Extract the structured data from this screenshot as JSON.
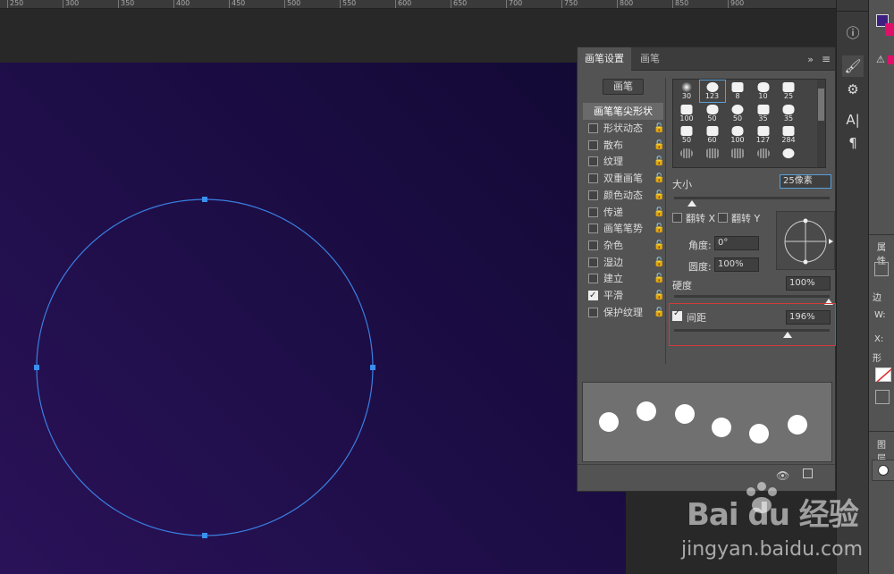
{
  "ruler": {
    "ticks": [
      "250",
      "300",
      "350",
      "400",
      "450",
      "500",
      "550",
      "600",
      "650",
      "700",
      "750",
      "800",
      "850",
      "900"
    ]
  },
  "panel": {
    "tabs": [
      "画笔设置",
      "画笔"
    ],
    "more_glyph": "»",
    "menu_glyph": "≡",
    "brush_button": "画笔",
    "tip_shape": "画笔笔尖形状",
    "lock_glyph": "🔓",
    "options": [
      {
        "label": "形状动态",
        "checked": false
      },
      {
        "label": "散布",
        "checked": false
      },
      {
        "label": "纹理",
        "checked": false
      },
      {
        "label": "双重画笔",
        "checked": false
      },
      {
        "label": "颜色动态",
        "checked": false
      },
      {
        "label": "传递",
        "checked": false
      },
      {
        "label": "画笔笔势",
        "checked": false
      },
      {
        "label": "杂色",
        "checked": false
      },
      {
        "label": "湿边",
        "checked": false
      },
      {
        "label": "建立",
        "checked": false
      },
      {
        "label": "平滑",
        "checked": true
      },
      {
        "label": "保护纹理",
        "checked": false
      }
    ],
    "presets": [
      "30",
      "123",
      "8",
      "10",
      "25",
      "100",
      "50",
      "50",
      "35",
      "35",
      "50",
      "60",
      "100",
      "127",
      "284",
      "",
      "",
      "",
      "",
      ""
    ],
    "size_label": "大小",
    "size_value": "25像素",
    "flip_x": "翻转 X",
    "flip_y": "翻转 Y",
    "angle_label": "角度:",
    "angle_value": "0°",
    "roundness_label": "圆度:",
    "roundness_value": "100%",
    "hardness_label": "硬度",
    "hardness_value": "100%",
    "spacing_label": "间距",
    "spacing_value": "196%",
    "spacing_checked": true,
    "footer_icons": [
      "eye-icon",
      "new-preset-icon"
    ]
  },
  "tools": [
    {
      "icon": "info-icon",
      "glyph": "ⓘ"
    },
    {
      "icon": "brush-icon",
      "glyph": "🖌"
    },
    {
      "icon": "sliders-icon",
      "glyph": "⚙"
    },
    {
      "icon": "character-icon",
      "glyph": "A|"
    },
    {
      "icon": "paragraph-icon",
      "glyph": "¶"
    }
  ],
  "dock": {
    "properties_label": "属性",
    "edge_label": "边",
    "w_label": "W:",
    "x_label": "X:",
    "shape_label": "形",
    "layers_label": "图层",
    "warning_glyph": "⚠"
  },
  "colors": {
    "canvas_a": "#2a1258",
    "canvas_b": "#120934",
    "path": "#3a7fe0",
    "foreground_swatch": "#3c1f80",
    "background_swatch": "#e0106a",
    "highlight": "#d33b3b"
  },
  "watermark": {
    "brand": "Bai du 经验",
    "url": "jingyan.baidu.com"
  }
}
